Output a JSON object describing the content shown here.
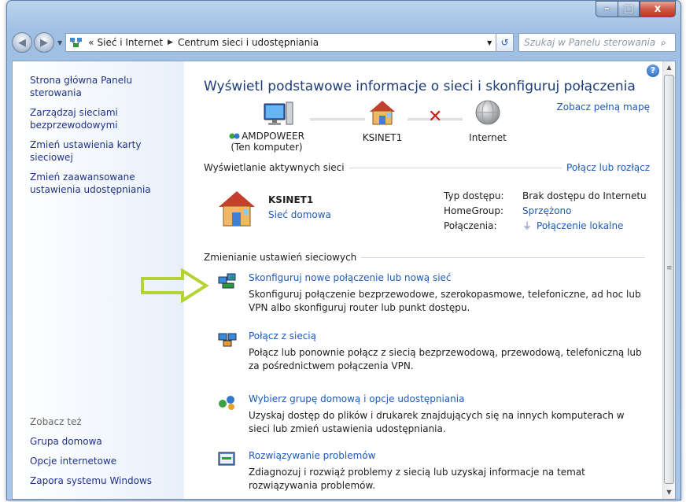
{
  "window": {
    "caption": {
      "minimize": "–",
      "maximize": "□",
      "close": "x"
    }
  },
  "address": {
    "chevrons": "«",
    "crumbs": [
      "Sieć i Internet",
      "Centrum sieci i udostępniania"
    ],
    "search_placeholder": "Szukaj w Panelu sterowania"
  },
  "sidebar": {
    "links": [
      "Strona główna Panelu sterowania",
      "Zarządzaj sieciami bezprzewodowymi",
      "Zmień ustawienia karty sieciowej",
      "Zmień zaawansowane ustawienia udostępniania"
    ],
    "see_also_title": "Zobacz też",
    "see_also": [
      "Grupa domowa",
      "Opcje internetowe",
      "Zapora systemu Windows"
    ]
  },
  "main": {
    "title": "Wyświetl podstawowe informacje o sieci i skonfiguruj połączenia",
    "full_map": "Zobacz pełną mapę",
    "map": {
      "computer": "AMDPOWEER",
      "computer_sub": "(Ten komputer)",
      "network": "KSINET1",
      "internet": "Internet"
    },
    "active_header": "Wyświetlanie aktywnych sieci",
    "connect_disconnect": "Połącz lub rozłącz",
    "active": {
      "name": "KSINET1",
      "type": "Sieć domowa",
      "props": [
        {
          "key": "Typ dostępu:",
          "value": "Brak dostępu do Internetu",
          "link": false
        },
        {
          "key": "HomeGroup:",
          "value": "Sprzężono",
          "link": true
        },
        {
          "key": "Połączenia:",
          "value": "Połączenie lokalne",
          "link": true
        }
      ]
    },
    "change_header": "Zmienianie ustawień sieciowych",
    "tasks": [
      {
        "title": "Skonfiguruj nowe połączenie lub nową sieć",
        "desc": "Skonfiguruj połączenie bezprzewodowe, szerokopasmowe, telefoniczne, ad hoc lub VPN albo skonfiguruj router lub punkt dostępu."
      },
      {
        "title": "Połącz z siecią",
        "desc": "Połącz lub ponownie połącz z siecią bezprzewodową, przewodową, telefoniczną lub za pośrednictwem połączenia VPN."
      },
      {
        "title": "Wybierz grupę domową i opcje udostępniania",
        "desc": "Uzyskaj dostęp do plików i drukarek znajdujących się na innych komputerach w sieci lub zmień ustawienia udostępniania."
      },
      {
        "title": "Rozwiązywanie problemów",
        "desc": "Zdiagnozuj i rozwiąż problemy z siecią lub uzyskaj informacje na temat rozwiązywania problemów."
      }
    ]
  },
  "colors": {
    "link": "#1e5ab4",
    "title": "#1e3c78",
    "annotation_arrow": "#b5d334",
    "error_x": "#d11c16"
  },
  "icons": [
    "back-icon",
    "forward-icon",
    "network-center-icon",
    "refresh-icon",
    "search-icon",
    "help-icon",
    "computer-icon",
    "house-icon",
    "globe-icon",
    "new-connection-icon",
    "connect-icon",
    "homegroup-icon",
    "troubleshoot-icon",
    "cable-icon",
    "annotation-arrow"
  ]
}
